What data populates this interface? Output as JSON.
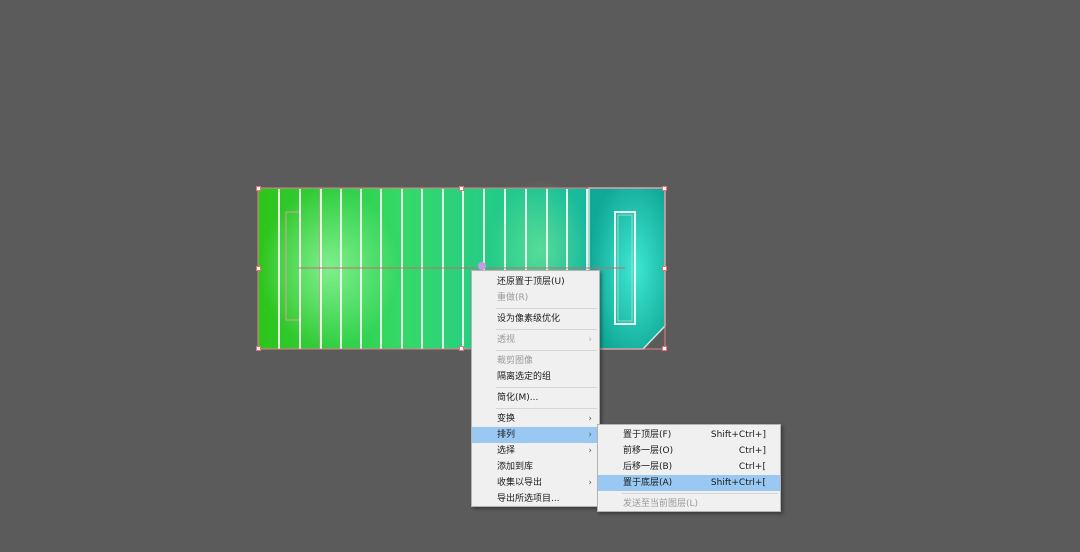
{
  "colors": {
    "canvas": "#5b5b5b",
    "menu_bg": "#f0f0f0",
    "menu_highlight": "#99c9f2",
    "art_green": "#2ecc1a",
    "art_teal": "#14b8a0"
  },
  "context_menu": {
    "items": [
      {
        "label": "还原置于顶层(U)",
        "disabled": false
      },
      {
        "label": "重做(R)",
        "disabled": true
      },
      {
        "label": "设为像素级优化",
        "disabled": false
      },
      {
        "label": "透视",
        "disabled": true,
        "submenu": true
      },
      {
        "label": "裁剪图像",
        "disabled": true
      },
      {
        "label": "隔离选定的组",
        "disabled": false
      },
      {
        "label": "简化(M)...",
        "disabled": false
      },
      {
        "label": "变换",
        "disabled": false,
        "submenu": true
      },
      {
        "label": "排列",
        "disabled": false,
        "submenu": true,
        "active": true
      },
      {
        "label": "选择",
        "disabled": false,
        "submenu": true
      },
      {
        "label": "添加到库",
        "disabled": false
      },
      {
        "label": "收集以导出",
        "disabled": false,
        "submenu": true
      },
      {
        "label": "导出所选项目...",
        "disabled": false
      }
    ]
  },
  "arrange_submenu": {
    "items": [
      {
        "label": "置于顶层(F)",
        "shortcut": "Shift+Ctrl+]"
      },
      {
        "label": "前移一层(O)",
        "shortcut": "Ctrl+]"
      },
      {
        "label": "后移一层(B)",
        "shortcut": "Ctrl+["
      },
      {
        "label": "置于底层(A)",
        "shortcut": "Shift+Ctrl+[",
        "active": true
      },
      {
        "label": "发送至当前图层(L)",
        "shortcut": "",
        "disabled": true
      }
    ]
  }
}
